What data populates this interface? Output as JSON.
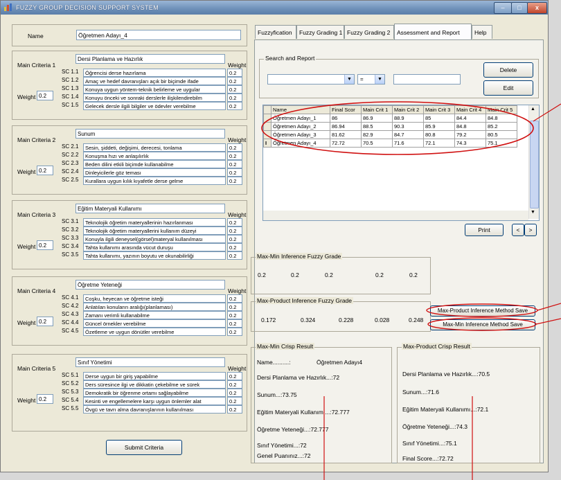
{
  "window": {
    "title": "FUZZY GROUP DECISION SUPPORT SYSTEM",
    "min": "–",
    "max": "□",
    "close": "x"
  },
  "name_label": "Name",
  "name_value": "Öğretmen Adayı_4",
  "weight_header": "Weight",
  "weight_label": "Weight",
  "criteria": [
    {
      "label": "Main Criteria 1",
      "name": "Dersi Planlama ve Hazırlık",
      "weight": "0.2",
      "subs": [
        {
          "code": "SC 1.1",
          "text": "Öğrencisi derse hazırlama",
          "w": "0.2"
        },
        {
          "code": "SC 1.2",
          "text": "Amaç ve hedef davranışları açık bir biçimde ifade",
          "w": "0.2"
        },
        {
          "code": "SC 1.3",
          "text": "Konuya uygun yöntem-teknik belirleme ve uygular",
          "w": "0.2"
        },
        {
          "code": "SC 1.4",
          "text": "Konuyu önceki ve sonraki derslerle ilişkilendirebilm",
          "w": "0.2"
        },
        {
          "code": "SC 1.5",
          "text": "Gelecek dersle ilgili bilgiler ve ödevler verebilme",
          "w": "0.2"
        }
      ]
    },
    {
      "label": "Main Criteria 2",
      "name": "Sunum",
      "weight": "0.2",
      "subs": [
        {
          "code": "SC 2.1",
          "text": "Sesin, şiddeti, değişimi, derecesi, tonlama",
          "w": "0.2"
        },
        {
          "code": "SC 2.2",
          "text": "Konuşma hızı ve anlaşılırlık",
          "w": "0.2"
        },
        {
          "code": "SC 2.3",
          "text": "Beden dilini etkili biçimde kullanabilme",
          "w": "0.2"
        },
        {
          "code": "SC 2.4",
          "text": "Dinleyicilerle göz teması",
          "w": "0.2"
        },
        {
          "code": "SC 2.5",
          "text": "Kurallara uygun kılık kıyafetle derse gelme",
          "w": "0.2"
        }
      ]
    },
    {
      "label": "Main Criteria 3",
      "name": "Eğitim Materyali Kullanımı",
      "weight": "0.2",
      "subs": [
        {
          "code": "SC 3.1",
          "text": "Teknolojik öğretim materyallerinin hazırlanması",
          "w": "0.2"
        },
        {
          "code": "SC 3.2",
          "text": "Teknolojik öğretim materyallerini kullanım düzeyi",
          "w": "0.2"
        },
        {
          "code": "SC 3.3",
          "text": "Konuyla ilgili deneysel(görsel)materyal kullanılması",
          "w": "0.2"
        },
        {
          "code": "SC 3.4",
          "text": "Tahta kullanımı arasında vücut duruşu",
          "w": "0.2"
        },
        {
          "code": "SC 3.5",
          "text": "Tahta kullanımı, yazının boyutu ve okunabilirliği",
          "w": "0.2"
        }
      ]
    },
    {
      "label": "Main Criteria 4",
      "name": "Öğretme Yeteneği",
      "weight": "0.2",
      "subs": [
        {
          "code": "SC 4.1",
          "text": "Coşku, heyecan ve öğretme isteği",
          "w": "0.2"
        },
        {
          "code": "SC 4.2",
          "text": "Anlatılan konuların aralığı(planlaması)",
          "w": "0.2"
        },
        {
          "code": "SC 4.3",
          "text": "Zamanı verimli kullanabilme",
          "w": "0.2"
        },
        {
          "code": "SC 4.4",
          "text": "Güncel örnekler verebilme",
          "w": "0.2"
        },
        {
          "code": "SC 4.5",
          "text": "Özetleme ve uygun dönütler verebilme",
          "w": "0.2"
        }
      ]
    },
    {
      "label": "Main Criteria 5",
      "name": "Sınıf Yönetimi",
      "weight": "0.2",
      "subs": [
        {
          "code": "SC 5.1",
          "text": "Derse uygun bir giriş yapabilme",
          "w": "0.2"
        },
        {
          "code": "SC 5.2",
          "text": "Ders süresince ilgi ve dikkatin çekebilme ve sürek",
          "w": "0.2"
        },
        {
          "code": "SC 5.3",
          "text": "Demokratik bir öğrenme ortamı sağlayabilme",
          "w": "0.2"
        },
        {
          "code": "SC 5.4",
          "text": "Kesinti ve engellemelere karşı uygun önlemler alat",
          "w": "0.2"
        },
        {
          "code": "SC 5.5",
          "text": "Övgü ve tavrı alma davranışlarının kullanılması",
          "w": "0.2"
        }
      ]
    }
  ],
  "submit_label": "Submit Criteria",
  "tabs": [
    "Fuzzyfication",
    "Fuzzy Grading 1",
    "Fuzzy Grading 2",
    "Assessment and Report",
    "Help"
  ],
  "search": {
    "title": "Search and Report",
    "op": "=",
    "delete": "Delete",
    "edit": "Edit"
  },
  "grid": {
    "headers": [
      "Name",
      "Final Scor",
      "Main Crit 1",
      "Main Crit 2",
      "Main Crit 3",
      "Main Crit 4",
      "Main Crit 5"
    ],
    "rows": [
      [
        "Öğretmen Adayı_1",
        "86",
        "86.9",
        "88.9",
        "85",
        "84.4",
        "84.8"
      ],
      [
        "Öğretmen Adayı_2",
        "86.94",
        "88.5",
        "90.3",
        "85.9",
        "84.8",
        "85.2"
      ],
      [
        "Öğretmen Adayı_3",
        "81.62",
        "82.9",
        "84.7",
        "80.8",
        "79.2",
        "80.5"
      ],
      [
        "Öğretmen Adayı_4",
        "72.72",
        "70.5",
        "71.6",
        "72.1",
        "74.3",
        "75.1"
      ]
    ],
    "current_marker": "I"
  },
  "print_label": "Print",
  "nav": {
    "prev": "<",
    "next": ">"
  },
  "maxmin_grade": {
    "title": "Max-Min Inference Fuzzy Grade",
    "values": [
      "0.2",
      "0.2",
      "0.2",
      "0.2",
      "0.2"
    ]
  },
  "maxprod_grade": {
    "title": "Max-Product Inference Fuzzy Grade",
    "values": [
      "0.172",
      "0.324",
      "0.228",
      "0.028",
      "0.248"
    ]
  },
  "save_maxprod": "Max-Product Inference Method Save",
  "save_maxmin": "Max-Min Inference Method Save",
  "maxmin_crisp": {
    "title": "Max-Min Crisp Result",
    "name_label": "Name..........:",
    "name_value": "Öğretmen Adayı4",
    "lines": [
      "Dersi Planlama ve Hazırlık...:72",
      "Sunum...:73.75",
      "Eğitim Materyali Kullanımı...:72.777",
      "Öğretme Yeteneği...:72.777",
      "Sınıf Yönetimi...:72",
      "Genel Puanınız...:72"
    ]
  },
  "maxprod_crisp": {
    "title": "Max-Product Crisp Result",
    "lines": [
      "Dersi Planlama ve Hazırlık...:70.5",
      "Sunum...:71.6",
      "Eğitim Materyali Kullanımı...:72.1",
      "Öğretme Yeteneği...:74.3",
      "Sınıf Yönetimi...:75.1",
      "Final Score...:72.72"
    ]
  },
  "colors": {
    "annotation": "#d01010",
    "title_bar": "#6d8fb8",
    "panel": "#ece9d8"
  }
}
